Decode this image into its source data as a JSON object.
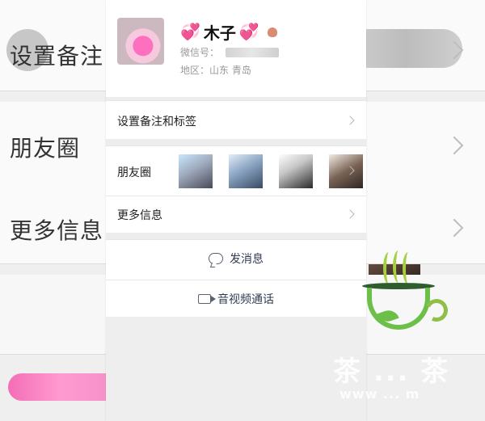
{
  "background": {
    "labels": [
      "设置备注",
      "朋友圈",
      "更多信息"
    ]
  },
  "profile": {
    "name": "木子",
    "heart_left": "💞",
    "heart_right": "💞",
    "wechat_id_label": "微信号：",
    "region": "地区：山东  青岛"
  },
  "menu": {
    "remark_tags": "设置备注和标签",
    "moments": "朋友圈",
    "more_info": "更多信息"
  },
  "actions": {
    "send_message": "发消息",
    "av_call": "音视频通话"
  },
  "icons": {
    "message": "chat-bubble-icon",
    "video": "video-camera-icon",
    "chevron": "chevron-right-icon"
  },
  "watermark": {
    "text": "茶 ... 茶",
    "url": "www ... m"
  }
}
